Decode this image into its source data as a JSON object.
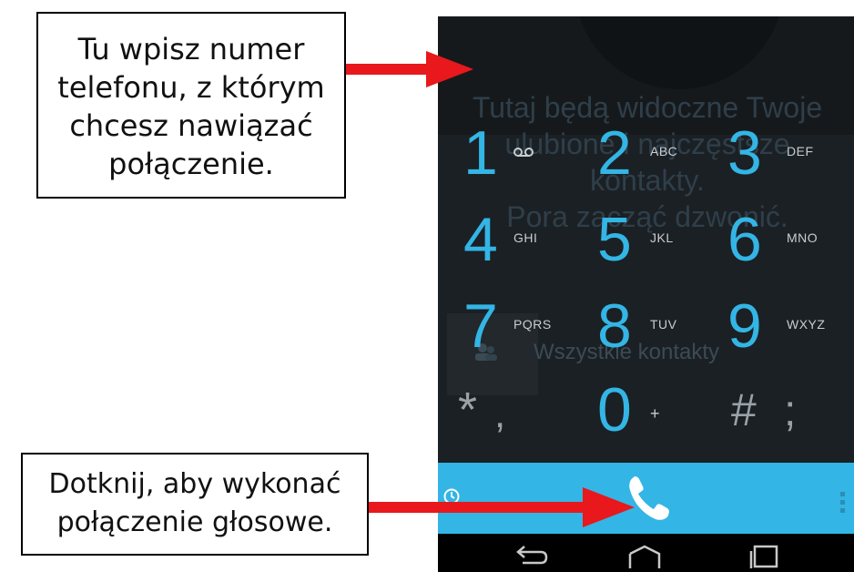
{
  "callouts": {
    "top": {
      "lines": [
        "Tu wpisz numer",
        "telefonu, z którym",
        "chcesz nawiązać",
        "połączenie."
      ]
    },
    "bottom": {
      "lines": [
        "Dotknij, aby wykonać",
        "połączenie głosowe."
      ]
    }
  },
  "background": {
    "empty_lines": [
      "Tutaj będą widoczne Twoje",
      "ulubione i najczęstsze",
      "kontakty.",
      "Pora zacząć dzwonić."
    ],
    "contacts_label": "Wszystkie kontakty"
  },
  "keypad": [
    {
      "digit": "1",
      "letters": "ꝏ"
    },
    {
      "digit": "2",
      "letters": "ABC"
    },
    {
      "digit": "3",
      "letters": "DEF"
    },
    {
      "digit": "4",
      "letters": "GHI"
    },
    {
      "digit": "5",
      "letters": "JKL"
    },
    {
      "digit": "6",
      "letters": "MNO"
    },
    {
      "digit": "7",
      "letters": "PQRS"
    },
    {
      "digit": "8",
      "letters": "TUV"
    },
    {
      "digit": "9",
      "letters": "WXYZ"
    },
    {
      "digit": "*",
      "letters": ","
    },
    {
      "digit": "0",
      "letters": "+"
    },
    {
      "digit": "#",
      "letters": ";"
    }
  ],
  "colors": {
    "accent": "#33b5e5",
    "arrow": "#e8181c",
    "phone_bg": "#1b2024"
  },
  "icons": {
    "history": "history-icon",
    "call": "phone-icon",
    "more": "overflow-menu-icon",
    "back": "back-icon",
    "home": "home-icon",
    "recent": "recent-apps-icon"
  }
}
